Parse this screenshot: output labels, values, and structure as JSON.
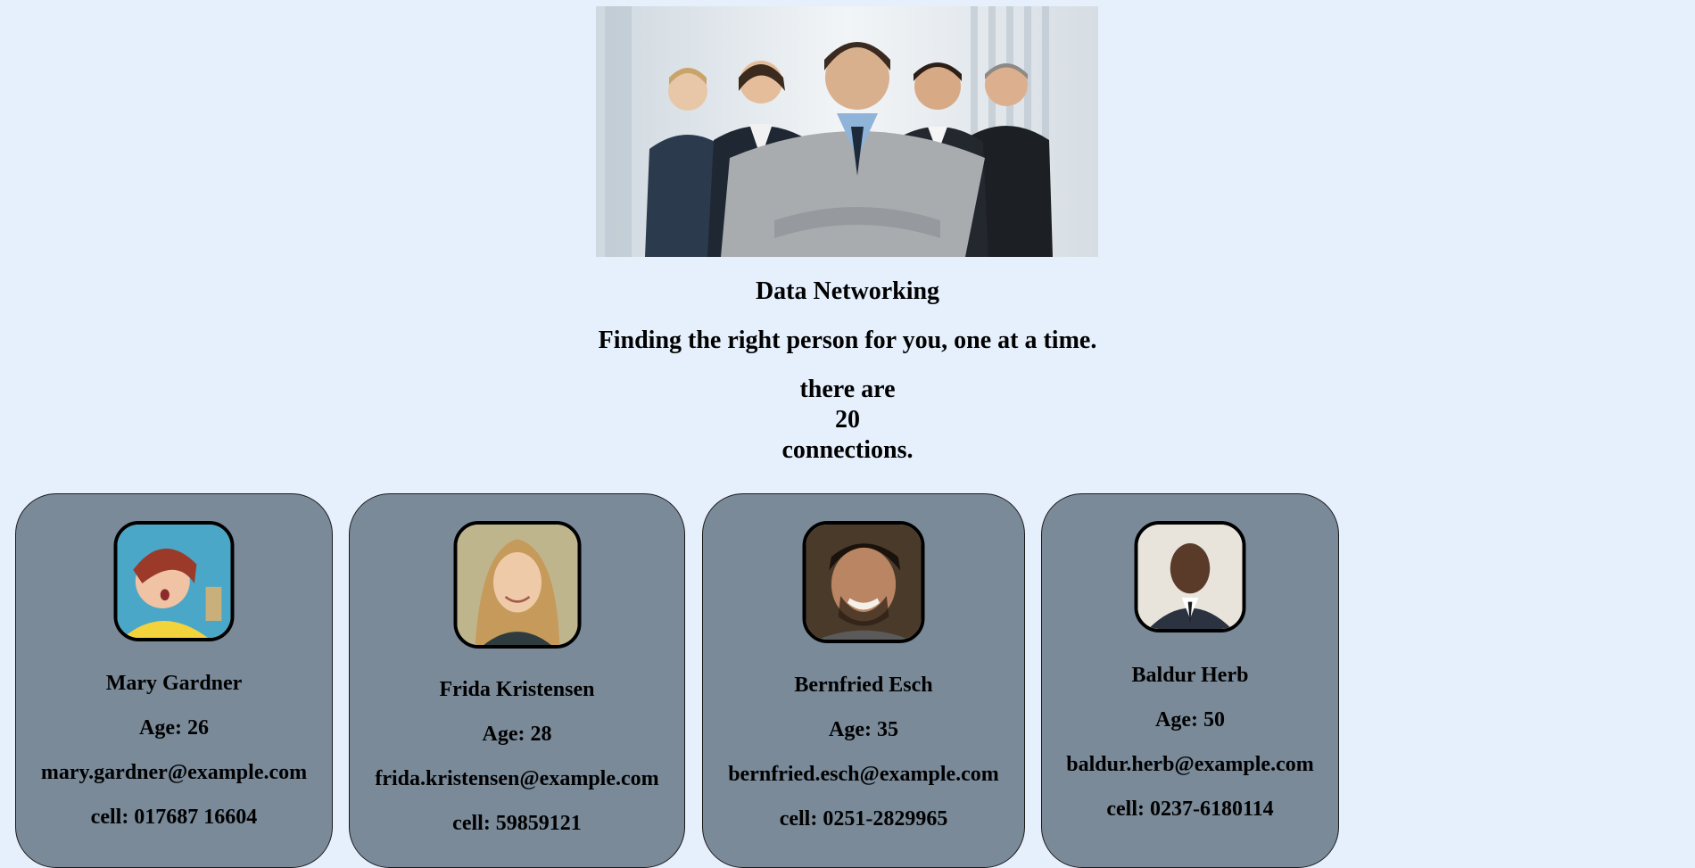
{
  "hero": {
    "image_description_icon": "team-photo"
  },
  "header": {
    "title": "Data Networking",
    "tagline": "Finding the right person for you, one at a time.",
    "count_prefix": "there are",
    "count": "20",
    "count_suffix": "connections."
  },
  "connections": [
    {
      "name": "Mary Gardner",
      "age": "Age: 26",
      "email": "mary.gardner@example.com",
      "cell": "cell: 017687 16604"
    },
    {
      "name": "Frida Kristensen",
      "age": "Age: 28",
      "email": "frida.kristensen@example.com",
      "cell": "cell: 59859121"
    },
    {
      "name": "Bernfried Esch",
      "age": "Age: 35",
      "email": "bernfried.esch@example.com",
      "cell": "cell: 0251-2829965"
    },
    {
      "name": "Baldur Herb",
      "age": "Age: 50",
      "email": "baldur.herb@example.com",
      "cell": "cell: 0237-6180114"
    }
  ],
  "colors": {
    "page_background": "#e6f0fd",
    "card_background": "#7a8a99",
    "card_border": "#1a1a1a"
  }
}
